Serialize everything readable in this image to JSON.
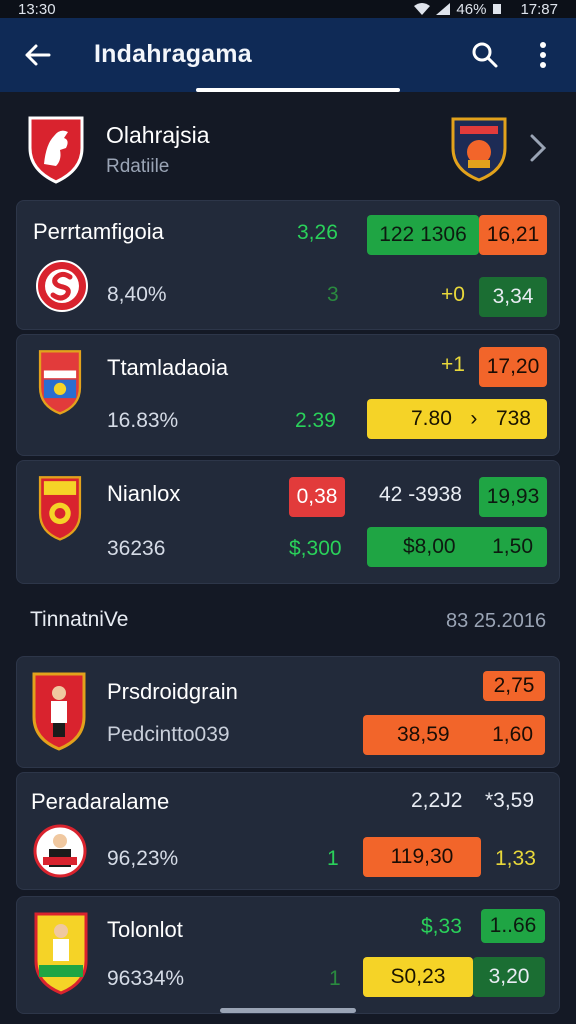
{
  "status_bar": {
    "time": "13:30",
    "battery": "46%",
    "right_time": "17:87"
  },
  "app_bar": {
    "title": "Indahragama"
  },
  "league": {
    "name": "Olahrajsia",
    "subtitle": "Rdatiile"
  },
  "cards": [
    {
      "name": "Perrtamfigoia",
      "percent": "8,40%",
      "v1": "3,26",
      "pill_a": "122 1306",
      "pill_b": "16,21",
      "v2": "3",
      "v3": "+0",
      "pill_c": "3,34"
    },
    {
      "name": "Ttamladaoia",
      "percent": "16.83%",
      "v1": "+1",
      "pill_a": "17,20",
      "v2": "2.39",
      "pill_b_left": "7.80",
      "pill_b_arrow": "›",
      "pill_b_right": "738"
    },
    {
      "name": "Nianlox",
      "percent": "36236",
      "pill_a": "0,38",
      "v1": "42 -3938",
      "pill_b": "19,93",
      "v2": "$,300",
      "pill_c_left": "$8,00",
      "pill_c_right": "1,50"
    }
  ],
  "section": {
    "title": "TinnatniVe",
    "date": "83 25.2016"
  },
  "matches": [
    {
      "name": "Prsdroidgrain",
      "sub": "Pedcintto039",
      "pill_top": "2,75",
      "pill_left": "38,59",
      "pill_right": "1,60"
    },
    {
      "name": "Peradaralame",
      "percent": "96,23%",
      "v1": "2,2J2",
      "v2": "*3,59",
      "v3": "1",
      "pill_a": "119,30",
      "v4": "1,33"
    },
    {
      "name": "Tolonlot",
      "percent": "96334%",
      "v1": "$,33",
      "pill_a": "1..66",
      "v2": "1",
      "pill_b": "S0,23",
      "pill_c": "3,20"
    }
  ],
  "colors": {
    "app_bar": "#0f2a56",
    "background": "#141925",
    "card": "#222a3a",
    "green": "#1fa544",
    "orange": "#f2652a",
    "yellow": "#f5d327",
    "red": "#e23b3b"
  }
}
